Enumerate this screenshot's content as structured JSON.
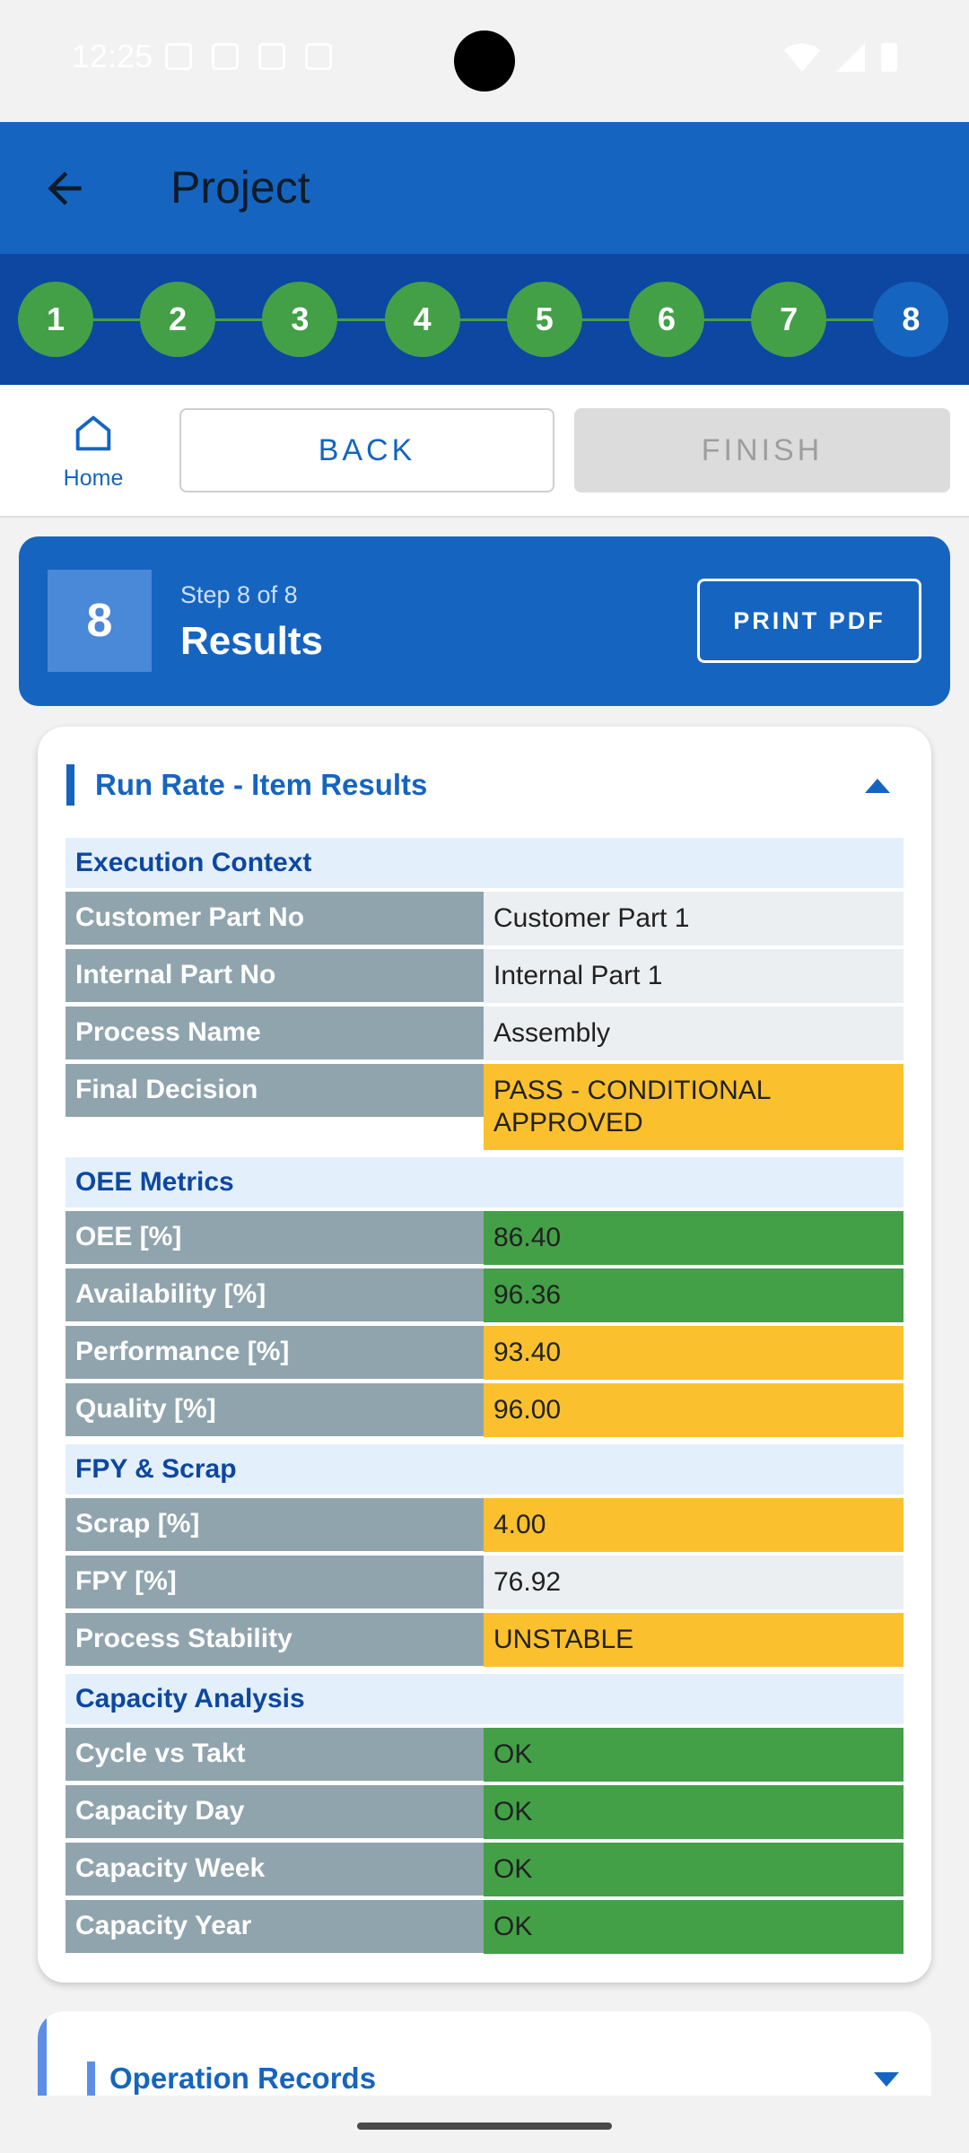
{
  "status_bar": {
    "time": "12:25"
  },
  "app_bar": {
    "title": "Project"
  },
  "stepper": {
    "steps": [
      "1",
      "2",
      "3",
      "4",
      "5",
      "6",
      "7",
      "8"
    ],
    "current": 8
  },
  "nav": {
    "home_label": "Home",
    "back_label": "BACK",
    "finish_label": "FINISH"
  },
  "step_header": {
    "number": "8",
    "subtitle": "Step 8 of 8",
    "title": "Results",
    "print_label": "PRINT PDF"
  },
  "results": {
    "title": "Run Rate - Item Results",
    "groups": [
      {
        "title": "Execution Context",
        "rows": [
          {
            "label": "Customer Part No",
            "value": "Customer Part 1",
            "status": "grey"
          },
          {
            "label": "Internal Part No",
            "value": "Internal Part 1",
            "status": "grey"
          },
          {
            "label": "Process Name",
            "value": "Assembly",
            "status": "grey"
          },
          {
            "label": "Final Decision",
            "value": "PASS - CONDITIONAL APPROVED",
            "status": "amber"
          }
        ]
      },
      {
        "title": "OEE Metrics",
        "rows": [
          {
            "label": "OEE [%]",
            "value": "86.40",
            "status": "green"
          },
          {
            "label": "Availability [%]",
            "value": "96.36",
            "status": "green"
          },
          {
            "label": "Performance [%]",
            "value": "93.40",
            "status": "amber"
          },
          {
            "label": "Quality [%]",
            "value": "96.00",
            "status": "amber"
          }
        ]
      },
      {
        "title": "FPY & Scrap",
        "rows": [
          {
            "label": "Scrap [%]",
            "value": "4.00",
            "status": "amber"
          },
          {
            "label": "FPY [%]",
            "value": "76.92",
            "status": "grey"
          },
          {
            "label": "Process Stability",
            "value": "UNSTABLE",
            "status": "amber"
          }
        ]
      },
      {
        "title": "Capacity Analysis",
        "rows": [
          {
            "label": "Cycle vs Takt",
            "value": "OK",
            "status": "green"
          },
          {
            "label": "Capacity Day",
            "value": "OK",
            "status": "green"
          },
          {
            "label": "Capacity Week",
            "value": "OK",
            "status": "green"
          },
          {
            "label": "Capacity Year",
            "value": "OK",
            "status": "green"
          }
        ]
      }
    ]
  },
  "operation_records": {
    "title": "Operation Records"
  },
  "colors": {
    "primary": "#1565c0",
    "dark_primary": "#0d47a1",
    "complete_step": "#43a047",
    "ok": "#43a047",
    "warning": "#fbc02d",
    "label_bg": "#90a4ae"
  }
}
